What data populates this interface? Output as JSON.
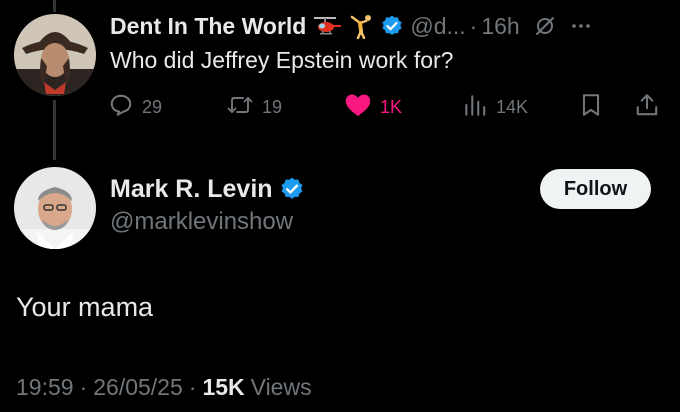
{
  "reply": {
    "name": "Dent In The World",
    "handle": "@d...",
    "separator": "·",
    "time": "16h",
    "text": "Who did Jeffrey Epstein work for?",
    "emoji_icons": [
      "helicopter-icon",
      "gymnast-icon"
    ],
    "actions": {
      "replies": "29",
      "reposts": "19",
      "likes": "1K",
      "views": "14K"
    },
    "like_color": "#f91880"
  },
  "tweet": {
    "name": "Mark R. Levin",
    "handle": "@marklevinshow",
    "follow_label": "Follow",
    "text": "Your mama",
    "time": "19:59",
    "date": "26/05/25",
    "views_count": "15K",
    "views_label": "Views",
    "separator": "·"
  },
  "colors": {
    "background": "#000000",
    "text": "#e7e9ea",
    "muted": "#71767b",
    "verified": "#1d9bf0"
  }
}
